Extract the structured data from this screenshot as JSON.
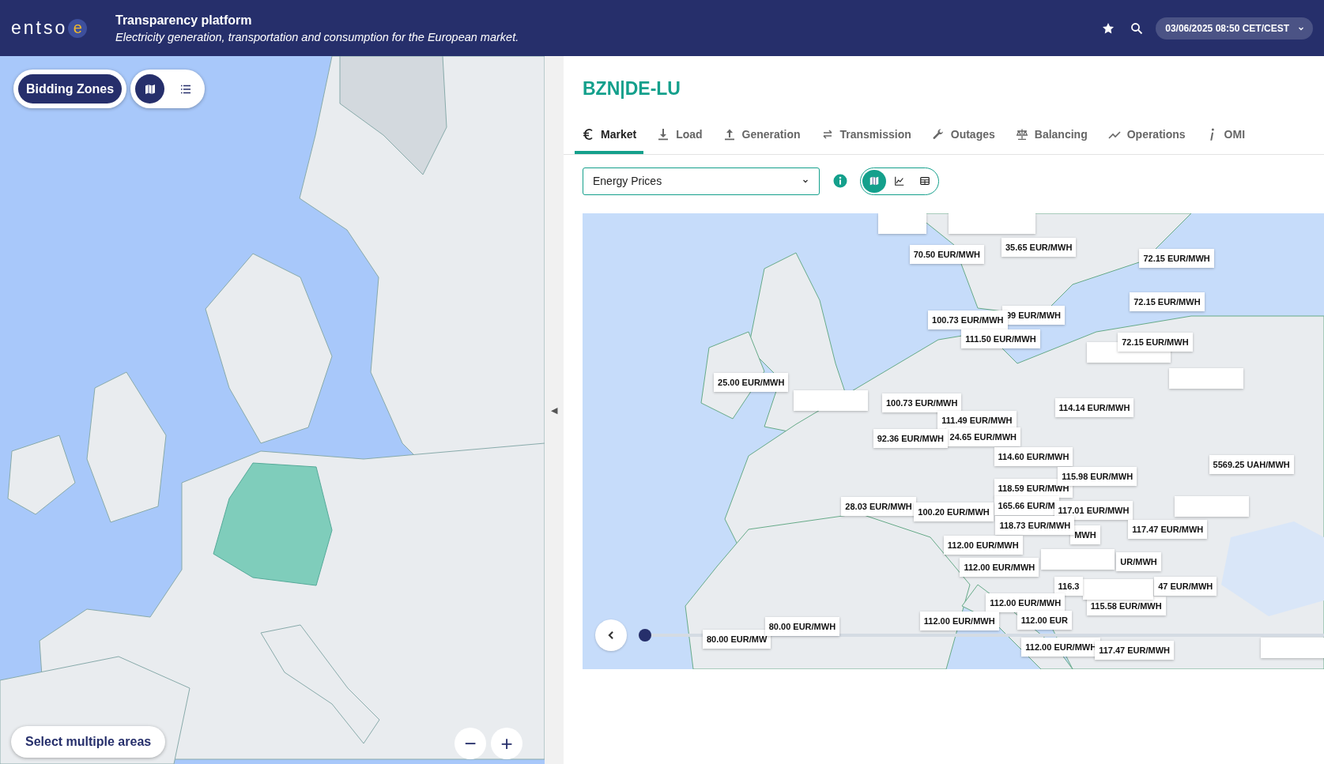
{
  "header": {
    "logo": "entso",
    "logo_mark": "e",
    "title": "Transparency platform",
    "subtitle": "Electricity generation, transportation and consumption for the European market.",
    "datetime": "03/06/2025 08:50 CET/CEST"
  },
  "left_panel": {
    "zone_button": "Bidding Zones",
    "view_toggle": [
      {
        "kind": "map",
        "selected": true
      },
      {
        "kind": "list",
        "selected": false
      }
    ],
    "select_button": "Select multiple areas",
    "zoom_out": "−",
    "zoom_in": "+",
    "collapse": "◀"
  },
  "area_title": "BZN|DE-LU",
  "tabs": [
    {
      "label": "Market",
      "kind": "euro",
      "selected": true
    },
    {
      "label": "Load",
      "kind": "download",
      "selected": false
    },
    {
      "label": "Generation",
      "kind": "upload",
      "selected": false
    },
    {
      "label": "Transmission",
      "kind": "arrows",
      "selected": false
    },
    {
      "label": "Outages",
      "kind": "wrench",
      "selected": false
    },
    {
      "label": "Balancing",
      "kind": "scale",
      "selected": false
    },
    {
      "label": "Operations",
      "kind": "trend",
      "selected": false
    },
    {
      "label": "OMI",
      "kind": "info",
      "selected": false
    }
  ],
  "dataset_select": {
    "value": "Energy Prices"
  },
  "view_modes": [
    {
      "kind": "map",
      "selected": true
    },
    {
      "kind": "chart",
      "selected": false
    },
    {
      "kind": "table",
      "selected": false
    }
  ],
  "map_labels": [
    "70.50 EUR/MWH",
    "35.65 EUR/MWH",
    "72.15 EUR/MWH",
    "72.15 EUR/MWH",
    "99 EUR/MWH",
    "100.73 EUR/MWH",
    "111.50 EUR/MWH",
    "72.15 EUR/MWH",
    "25.00 EUR/MWH",
    "100.73 EUR/MWH",
    "114.14 EUR/MWH",
    "111.49 EUR/MWH",
    "24.65 EUR/MWH",
    "92.36 EUR/MWH",
    "114.60 EUR/MWH",
    "5569.25 UAH/MWH",
    "115.98 EUR/MWH",
    "118.59 EUR/MWH",
    "28.03 EUR/MWH",
    "165.66 EUR/M",
    "100.20 EUR/MWH",
    "117.01 EUR/MWH",
    "118.73 EUR/MWH",
    "117.47 EUR/MWH",
    "MWH",
    "112.00 EUR/MWH",
    "UR/MWH",
    "112.00 EUR/MWH",
    "116.3",
    "47 EUR/MWH",
    "115.58 EUR/MWH",
    "112.00 EUR/MWH",
    "112.00 EUR/MWH",
    "112.00 EUR",
    "80.00 EUR/MW",
    "80.00 EUR/MWH",
    "112.00 EUR/MWH",
    "117.47 EUR/MWH"
  ],
  "timeline": {
    "level": 0
  }
}
